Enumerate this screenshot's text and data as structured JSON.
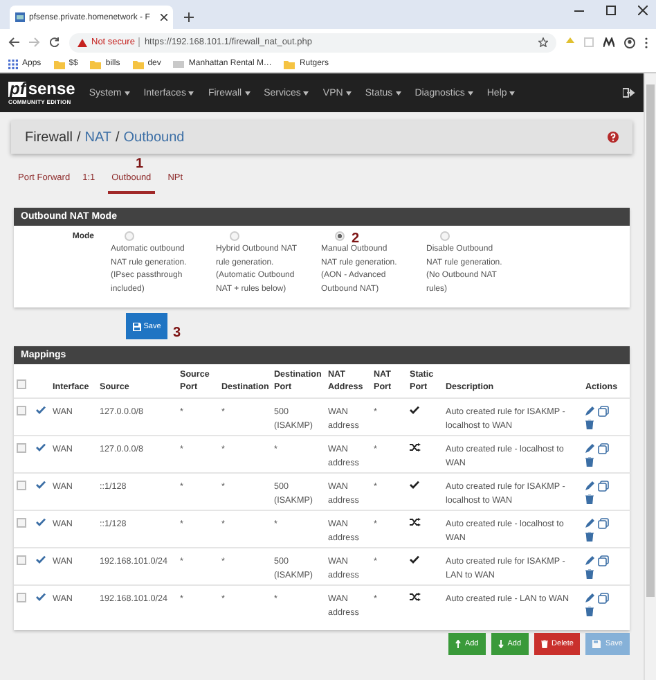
{
  "browser": {
    "tab_title": "pfsense.private.homenetwork - F",
    "security": "Not secure",
    "url": "https://192.168.101.1/firewall_nat_out.php",
    "bookmarks": [
      {
        "label": "Apps",
        "kind": "apps"
      },
      {
        "label": "$$",
        "kind": "folder"
      },
      {
        "label": "bills",
        "kind": "folder"
      },
      {
        "label": "dev",
        "kind": "folder"
      },
      {
        "label": "Manhattan Rental M…",
        "kind": "page"
      },
      {
        "label": "Rutgers",
        "kind": "folder"
      }
    ]
  },
  "navbar": {
    "logo": {
      "mark": "pf",
      "name": "sense",
      "edition": "COMMUNITY EDITION"
    },
    "menus": [
      "System",
      "Interfaces",
      "Firewall",
      "Services",
      "VPN",
      "Status",
      "Diagnostics",
      "Help"
    ]
  },
  "breadcrumb": [
    {
      "label": "Firewall",
      "link": false,
      "separator": "/"
    },
    {
      "label": "NAT",
      "link": true,
      "separator": "/"
    },
    {
      "label": "Outbound",
      "link": true
    }
  ],
  "tabs": [
    {
      "label": "Port Forward",
      "selected": false
    },
    {
      "label": "1:1",
      "selected": false
    },
    {
      "label": "Outbound",
      "selected": true
    },
    {
      "label": "NPt",
      "selected": false
    }
  ],
  "annotations": [
    "1",
    "2",
    "3"
  ],
  "mode_panel": {
    "title": "Outbound NAT Mode",
    "label": "Mode",
    "options": [
      {
        "text": "Automatic outbound NAT rule generation. (IPsec passthrough included)",
        "selected": false
      },
      {
        "text": "Hybrid Outbound NAT rule generation. (Automatic Outbound NAT + rules below)",
        "selected": false
      },
      {
        "text": "Manual Outbound NAT rule generation. (AON - Advanced Outbound NAT)",
        "selected": true
      },
      {
        "text": "Disable Outbound NAT rule generation. (No Outbound NAT rules)",
        "selected": false
      }
    ]
  },
  "save_button": "Save",
  "mappings": {
    "title": "Mappings",
    "select_all": false,
    "columns": [
      "Interface",
      "Source",
      "Source Port",
      "Destination",
      "Destination Port",
      "NAT Address",
      "NAT Port",
      "Static Port",
      "Description",
      "Actions"
    ],
    "rows": [
      {
        "checked": false,
        "enabled": true,
        "interface": "WAN",
        "source": "127.0.0.0/8",
        "source_port": "*",
        "destination": "*",
        "destination_port": "500 (ISAKMP)",
        "nat_address": "WAN address",
        "nat_port": "*",
        "static_port": true,
        "description": "Auto created rule for ISAKMP - localhost to WAN"
      },
      {
        "checked": false,
        "enabled": true,
        "interface": "WAN",
        "source": "127.0.0.0/8",
        "source_port": "*",
        "destination": "*",
        "destination_port": "*",
        "nat_address": "WAN address",
        "nat_port": "*",
        "static_port": false,
        "description": "Auto created rule - localhost to WAN"
      },
      {
        "checked": false,
        "enabled": true,
        "interface": "WAN",
        "source": "::1/128",
        "source_port": "*",
        "destination": "*",
        "destination_port": "500 (ISAKMP)",
        "nat_address": "WAN address",
        "nat_port": "*",
        "static_port": true,
        "description": "Auto created rule for ISAKMP - localhost to WAN"
      },
      {
        "checked": false,
        "enabled": true,
        "interface": "WAN",
        "source": "::1/128",
        "source_port": "*",
        "destination": "*",
        "destination_port": "*",
        "nat_address": "WAN address",
        "nat_port": "*",
        "static_port": false,
        "description": "Auto created rule - localhost to WAN"
      },
      {
        "checked": false,
        "enabled": true,
        "interface": "WAN",
        "source": "192.168.101.0/24",
        "source_port": "*",
        "destination": "*",
        "destination_port": "500 (ISAKMP)",
        "nat_address": "WAN address",
        "nat_port": "*",
        "static_port": true,
        "description": "Auto created rule for ISAKMP - LAN to WAN"
      },
      {
        "checked": false,
        "enabled": true,
        "interface": "WAN",
        "source": "192.168.101.0/24",
        "source_port": "*",
        "destination": "*",
        "destination_port": "*",
        "nat_address": "WAN address",
        "nat_port": "*",
        "static_port": false,
        "description": "Auto created rule - LAN to WAN"
      }
    ]
  },
  "buttons": [
    {
      "kind": "add_top",
      "label": "Add",
      "disabled": false
    },
    {
      "kind": "add_bottom",
      "label": "Add",
      "disabled": false
    },
    {
      "kind": "delete",
      "label": "Delete",
      "disabled": false
    },
    {
      "kind": "save",
      "label": "Save",
      "disabled": true
    }
  ]
}
